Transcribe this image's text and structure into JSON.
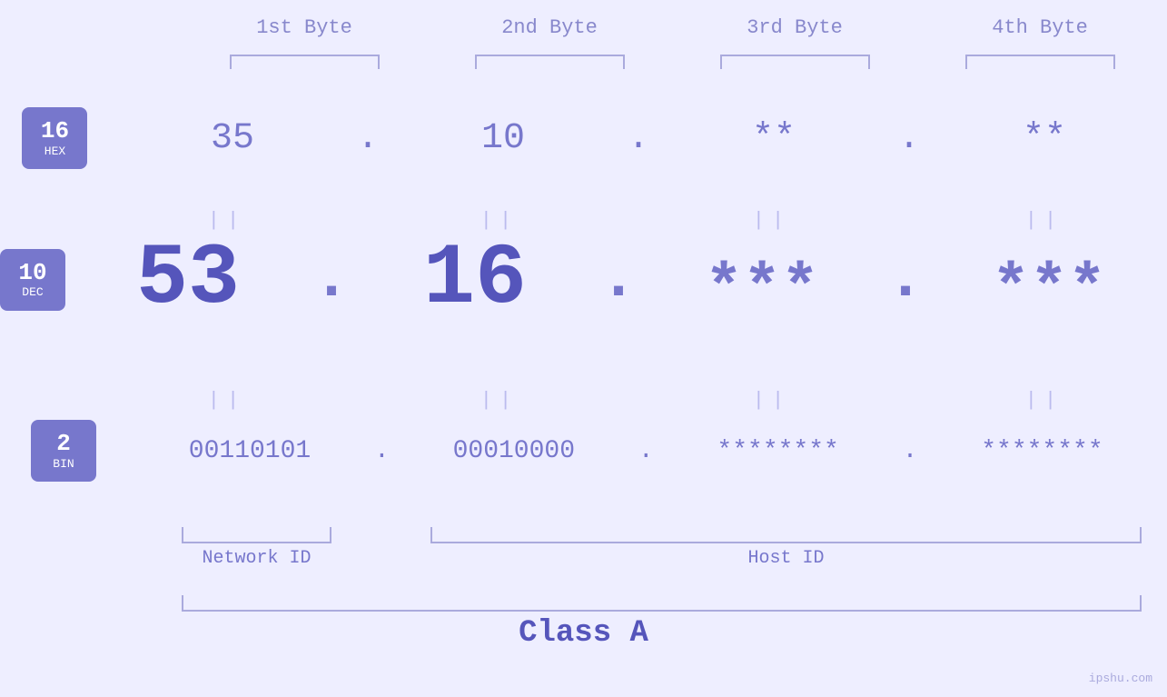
{
  "headers": {
    "byte1": "1st Byte",
    "byte2": "2nd Byte",
    "byte3": "3rd Byte",
    "byte4": "4th Byte"
  },
  "badges": {
    "hex": {
      "num": "16",
      "base": "HEX"
    },
    "dec": {
      "num": "10",
      "base": "DEC"
    },
    "bin": {
      "num": "2",
      "base": "BIN"
    }
  },
  "hex_values": {
    "b1": "35",
    "b2": "10",
    "b3": "**",
    "b4": "**"
  },
  "dec_values": {
    "b1": "53",
    "b2": "16",
    "b3": "***",
    "b4": "***"
  },
  "bin_values": {
    "b1": "00110101",
    "b2": "00010000",
    "b3": "********",
    "b4": "********"
  },
  "labels": {
    "network_id": "Network ID",
    "host_id": "Host ID",
    "class": "Class A"
  },
  "separator": ".",
  "equals": "||",
  "watermark": "ipshu.com",
  "colors": {
    "accent": "#7777cc",
    "light": "#aaaadd",
    "bg": "#eeeeff",
    "dec_bold": "#5555bb"
  }
}
